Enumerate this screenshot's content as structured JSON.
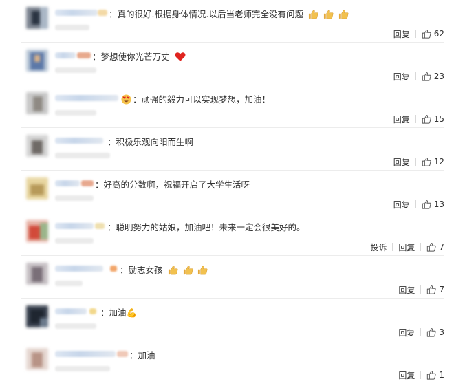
{
  "comments": [
    {
      "text": "真的很好.根据身体情况.以后当老师完全没有问题",
      "emoji": "thumbs-up",
      "emoji_count": 3,
      "reply": "回复",
      "likes": "62"
    },
    {
      "text": "梦想使你光芒万丈",
      "emoji": "red-heart",
      "emoji_count": 1,
      "reply": "回复",
      "likes": "23"
    },
    {
      "lead_emoji": "heart-eyes",
      "text": "顽强的毅力可以实现梦想，加油！",
      "reply": "回复",
      "likes": "15"
    },
    {
      "text": "积极乐观向阳而生啊",
      "reply": "回复",
      "likes": "12"
    },
    {
      "text": "好高的分数啊，祝福开启了大学生活呀",
      "reply": "回复",
      "likes": "13"
    },
    {
      "text": "聪明努力的姑娘，加油吧！未来一定会很美好的。",
      "report": "投诉",
      "reply": "回复",
      "likes": "7"
    },
    {
      "text": "励志女孩",
      "emoji": "thumbs-up",
      "emoji_count": 3,
      "reply": "回复",
      "likes": "7"
    },
    {
      "text": "加油💪",
      "reply": "回复",
      "likes": "3"
    },
    {
      "text": "加油",
      "reply": "回复",
      "likes": "1"
    }
  ],
  "icons": {
    "like": "thumbs-up-outline-icon",
    "thumb_emoji": "thumbs-up-emoji-icon",
    "heart": "red-heart-emoji",
    "heart_eyes": "heart-eyes-emoji"
  },
  "colors": {
    "text": "#333333",
    "separator": "#ececec",
    "like_icon": "#555555",
    "heart": "#e0241f",
    "thumb": "#f2c14e"
  }
}
